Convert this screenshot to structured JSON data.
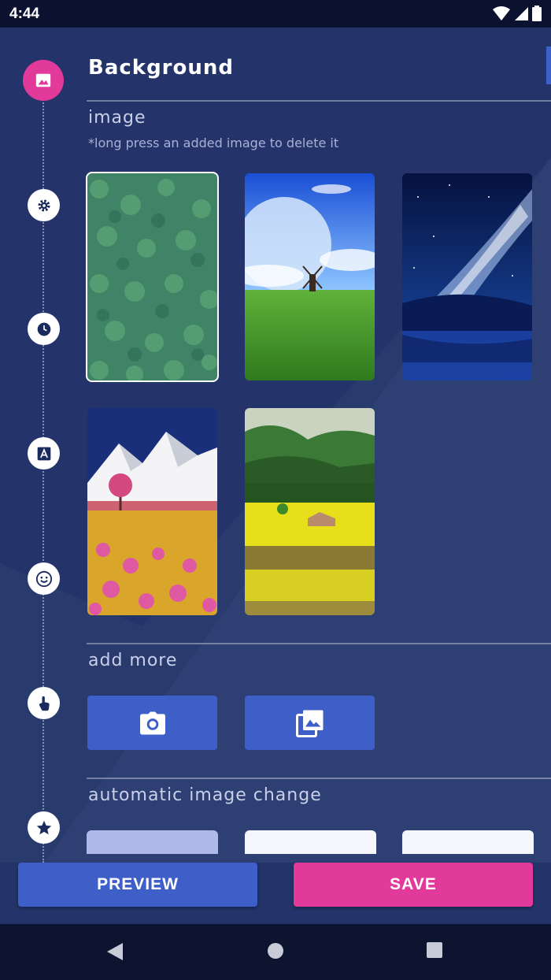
{
  "status_bar": {
    "time": "4:44"
  },
  "header": {
    "title": "Background"
  },
  "image_section": {
    "label": "image",
    "hint": "*long press an added image to delete it",
    "thumbnails": [
      {
        "name": "clover-pattern",
        "selected": true
      },
      {
        "name": "windmill-field",
        "selected": false
      },
      {
        "name": "night-sky-galaxy",
        "selected": false
      },
      {
        "name": "snowy-mountain-flowers",
        "selected": false
      },
      {
        "name": "valley-field-cabin",
        "selected": false
      }
    ]
  },
  "add_more": {
    "label": "add more",
    "buttons": [
      {
        "icon": "camera-icon"
      },
      {
        "icon": "gallery-icon"
      }
    ]
  },
  "auto_change": {
    "label": "automatic image change"
  },
  "timeline_steps": [
    "image-icon",
    "settings-icon",
    "clock-icon",
    "font-icon",
    "emoji-icon",
    "touch-icon",
    "star-icon"
  ],
  "actions": {
    "preview_label": "PREVIEW",
    "save_label": "SAVE"
  },
  "colors": {
    "background": "#24346a",
    "accent_blue": "#3e5ec8",
    "accent_pink": "#e23a9b",
    "status_bar": "#0a1230"
  }
}
